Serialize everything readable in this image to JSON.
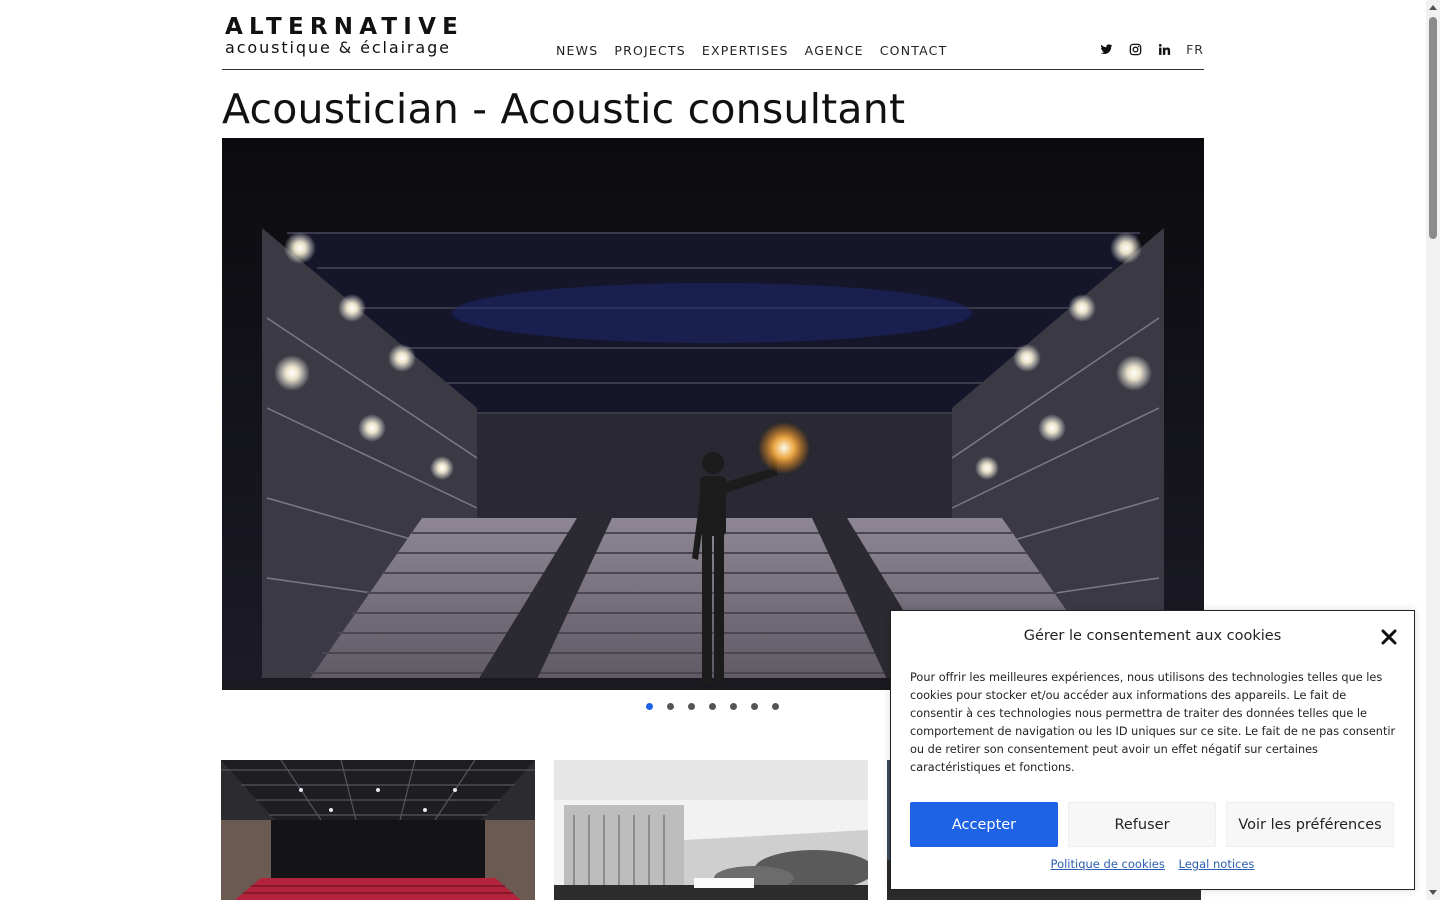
{
  "logo": {
    "main": "ALTERNATIVE",
    "sub": "acoustique & éclairage"
  },
  "nav": [
    {
      "label": "NEWS"
    },
    {
      "label": "PROJECTS"
    },
    {
      "label": "EXPERTISES"
    },
    {
      "label": "AGENCE"
    },
    {
      "label": "CONTACT"
    }
  ],
  "social": [
    {
      "icon": "twitter-icon"
    },
    {
      "icon": "instagram-icon"
    },
    {
      "icon": "linkedin-icon"
    }
  ],
  "language": "FR",
  "page_title": "Acoustician - Acoustic consultant",
  "slider": {
    "total": 7,
    "active_index": 0
  },
  "cookie": {
    "title": "Gérer le consentement aux cookies",
    "text": "Pour offrir les meilleures expériences, nous utilisons des technologies telles que les cookies pour stocker et/ou accéder aux informations des appareils. Le fait de consentir à ces technologies nous permettra de traiter des données telles que le comportement de navigation ou les ID uniques sur ce site. Le fait de ne pas consentir ou de retirer son consentement peut avoir un effet négatif sur certaines caractéristiques et fonctions.",
    "accept": "Accepter",
    "refuse": "Refuser",
    "preferences": "Voir les préférences",
    "link_cookie_policy": "Politique de cookies",
    "link_legal": "Legal notices"
  },
  "colors": {
    "accent": "#1e63e6",
    "link": "#2a5db0",
    "text": "#111111"
  }
}
